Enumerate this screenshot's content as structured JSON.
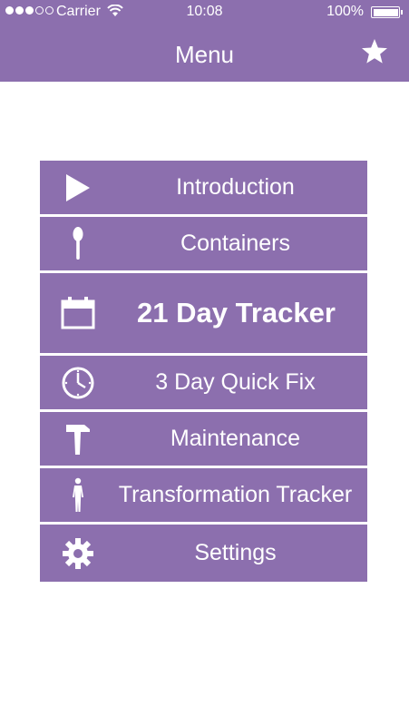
{
  "status_bar": {
    "carrier": "Carrier",
    "time": "10:08",
    "battery": "100%"
  },
  "header": {
    "title": "Menu",
    "star_icon": "star-icon"
  },
  "menu": {
    "items": [
      {
        "label": "Introduction",
        "icon": "play-icon"
      },
      {
        "label": "Containers",
        "icon": "spoon-icon"
      },
      {
        "label": "21 Day Tracker",
        "icon": "calendar-icon"
      },
      {
        "label": "3 Day Quick Fix",
        "icon": "clock-icon"
      },
      {
        "label": "Maintenance",
        "icon": "hammer-icon"
      },
      {
        "label": "Transformation Tracker",
        "icon": "body-icon"
      },
      {
        "label": "Settings",
        "icon": "gear-icon"
      }
    ]
  },
  "colors": {
    "accent": "#8c6fae",
    "text": "#ffffff",
    "background": "#ffffff"
  }
}
